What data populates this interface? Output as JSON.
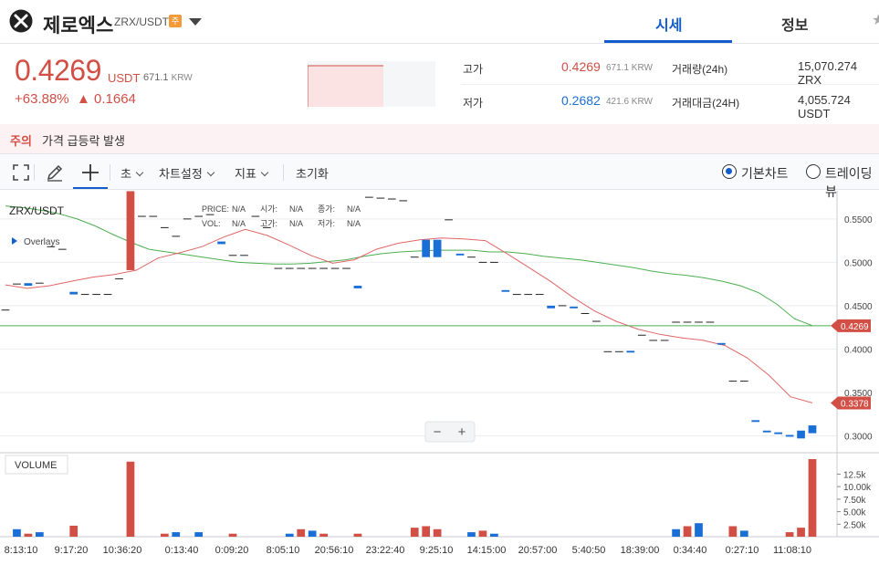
{
  "header": {
    "coin_name": "제로엑스",
    "pair": "ZRX/USDT",
    "warning_badge": "주",
    "tabs": [
      {
        "label": "시세",
        "active": true
      },
      {
        "label": "정보",
        "active": false
      }
    ]
  },
  "price": {
    "current": "0.4269",
    "unit": "USDT",
    "krw": "671.1",
    "krw_unit": "KRW",
    "change_pct": "+63.88%",
    "change_abs": "▲ 0.1664"
  },
  "stats": {
    "high_label": "고가",
    "high_value": "0.4269",
    "high_krw": "671.1 KRW",
    "low_label": "저가",
    "low_value": "0.2682",
    "low_krw": "421.6 KRW",
    "volume_label": "거래량(24h)",
    "volume_value": "15,070.274 ZRX",
    "amount_label": "거래대금(24H)",
    "amount_value": "4,055.724 USDT"
  },
  "banner": {
    "tag": "주의",
    "text": "가격 급등락 발생"
  },
  "toolbar": {
    "interval": "초",
    "chart_settings": "차트설정",
    "indicators": "지표",
    "reset": "초기화",
    "basic_chart": "기본차트",
    "tradingview": "트레이딩뷰"
  },
  "colors": {
    "up": "#d24f45",
    "down": "#1a6fd6",
    "accent": "#115dcb",
    "ma_green": "#4caf50",
    "ma_red": "#e06666"
  },
  "chart_data": {
    "type": "candlestick",
    "symbol": "ZRX/USDT",
    "overlays_label": "Overlays",
    "legend": {
      "price_label": "PRICE:",
      "price": "N/A",
      "open_label": "시가:",
      "open": "N/A",
      "close_label": "종가:",
      "close": "N/A",
      "vol_label": "VOL:",
      "vol": "N/A",
      "high_label": "고가:",
      "high": "N/A",
      "low_label": "저가:",
      "low": "N/A"
    },
    "y_ticks": [
      "0.5500",
      "0.5000",
      "0.4500",
      "0.4000",
      "0.3500",
      "0.3000"
    ],
    "y_tick_values": [
      0.55,
      0.5,
      0.45,
      0.4,
      0.35,
      0.3
    ],
    "ylim": [
      0.2805,
      0.5825
    ],
    "last_price_tag": "0.4269",
    "last_price_value": 0.4269,
    "ma_tag": "0.3378",
    "ma_tag_value": 0.3378,
    "x_ticks": [
      "8:13:10",
      "9:17:20",
      "10:36:20",
      "0:13:40",
      "0:09:20",
      "8:05:10",
      "20:56:10",
      "23:22:40",
      "9:25:10",
      "14:15:00",
      "20:57:00",
      "5:40:50",
      "18:39:00",
      "0:34:40",
      "0:27:10",
      "11:08:10"
    ],
    "volume_title": "VOLUME",
    "volume_ticks": [
      "12.5k",
      "10.00k",
      "7.50k",
      "5.00k",
      "2.50k"
    ],
    "volume_tick_values": [
      12500,
      10000,
      7500,
      5000,
      2500
    ],
    "volume_max": 15500,
    "candles": [
      {
        "i": 0,
        "o": 0.445,
        "c": 0.445,
        "h": 0.445,
        "l": 0.445
      },
      {
        "i": 1,
        "o": 0.475,
        "c": 0.475,
        "h": 0.475,
        "l": 0.475
      },
      {
        "i": 2,
        "o": 0.476,
        "c": 0.473,
        "h": 0.476,
        "l": 0.473
      },
      {
        "i": 3,
        "o": 0.476,
        "c": 0.476,
        "h": 0.476,
        "l": 0.476
      },
      {
        "i": 4,
        "o": 0.518,
        "c": 0.518,
        "h": 0.518,
        "l": 0.518
      },
      {
        "i": 5,
        "o": 0.515,
        "c": 0.515,
        "h": 0.515,
        "l": 0.515
      },
      {
        "i": 6,
        "o": 0.466,
        "c": 0.463,
        "h": 0.466,
        "l": 0.463
      },
      {
        "i": 7,
        "o": 0.463,
        "c": 0.463,
        "h": 0.463,
        "l": 0.463
      },
      {
        "i": 8,
        "o": 0.463,
        "c": 0.463,
        "h": 0.463,
        "l": 0.463
      },
      {
        "i": 9,
        "o": 0.463,
        "c": 0.463,
        "h": 0.463,
        "l": 0.463
      },
      {
        "i": 10,
        "o": 0.481,
        "c": 0.481,
        "h": 0.481,
        "l": 0.481
      },
      {
        "i": 11,
        "o": 0.491,
        "c": 0.582,
        "h": 0.582,
        "l": 0.491
      },
      {
        "i": 12,
        "o": 0.553,
        "c": 0.553,
        "h": 0.553,
        "l": 0.553
      },
      {
        "i": 13,
        "o": 0.553,
        "c": 0.553,
        "h": 0.553,
        "l": 0.553
      },
      {
        "i": 14,
        "o": 0.54,
        "c": 0.54,
        "h": 0.54,
        "l": 0.54
      },
      {
        "i": 15,
        "o": 0.53,
        "c": 0.53,
        "h": 0.53,
        "l": 0.53
      },
      {
        "i": 16,
        "o": 0.55,
        "c": 0.55,
        "h": 0.55,
        "l": 0.55
      },
      {
        "i": 17,
        "o": 0.553,
        "c": 0.553,
        "h": 0.553,
        "l": 0.553
      },
      {
        "i": 18,
        "o": 0.555,
        "c": 0.555,
        "h": 0.555,
        "l": 0.555
      },
      {
        "i": 19,
        "o": 0.524,
        "c": 0.521,
        "h": 0.524,
        "l": 0.521
      },
      {
        "i": 20,
        "o": 0.508,
        "c": 0.508,
        "h": 0.508,
        "l": 0.508
      },
      {
        "i": 21,
        "o": 0.508,
        "c": 0.508,
        "h": 0.508,
        "l": 0.508
      },
      {
        "i": 22,
        "o": 0.553,
        "c": 0.553,
        "h": 0.553,
        "l": 0.553
      },
      {
        "i": 23,
        "o": 0.54,
        "c": 0.54,
        "h": 0.54,
        "l": 0.54
      },
      {
        "i": 24,
        "o": 0.493,
        "c": 0.493,
        "h": 0.493,
        "l": 0.493
      },
      {
        "i": 25,
        "o": 0.493,
        "c": 0.493,
        "h": 0.493,
        "l": 0.493
      },
      {
        "i": 26,
        "o": 0.493,
        "c": 0.493,
        "h": 0.493,
        "l": 0.493
      },
      {
        "i": 27,
        "o": 0.493,
        "c": 0.493,
        "h": 0.493,
        "l": 0.493
      },
      {
        "i": 28,
        "o": 0.493,
        "c": 0.493,
        "h": 0.493,
        "l": 0.493
      },
      {
        "i": 29,
        "o": 0.493,
        "c": 0.493,
        "h": 0.493,
        "l": 0.493
      },
      {
        "i": 30,
        "o": 0.493,
        "c": 0.493,
        "h": 0.493,
        "l": 0.493
      },
      {
        "i": 31,
        "o": 0.473,
        "c": 0.47,
        "h": 0.473,
        "l": 0.47
      },
      {
        "i": 32,
        "o": 0.575,
        "c": 0.575,
        "h": 0.575,
        "l": 0.575
      },
      {
        "i": 33,
        "o": 0.574,
        "c": 0.574,
        "h": 0.574,
        "l": 0.574
      },
      {
        "i": 34,
        "o": 0.573,
        "c": 0.573,
        "h": 0.573,
        "l": 0.573
      },
      {
        "i": 35,
        "o": 0.571,
        "c": 0.571,
        "h": 0.571,
        "l": 0.571
      },
      {
        "i": 36,
        "o": 0.506,
        "c": 0.506,
        "h": 0.506,
        "l": 0.506
      },
      {
        "i": 37,
        "o": 0.526,
        "c": 0.506,
        "h": 0.526,
        "l": 0.506
      },
      {
        "i": 38,
        "o": 0.526,
        "c": 0.506,
        "h": 0.526,
        "l": 0.506
      },
      {
        "i": 39,
        "o": 0.549,
        "c": 0.549,
        "h": 0.549,
        "l": 0.549
      },
      {
        "i": 40,
        "o": 0.51,
        "c": 0.508,
        "h": 0.51,
        "l": 0.508
      },
      {
        "i": 41,
        "o": 0.506,
        "c": 0.506,
        "h": 0.506,
        "l": 0.506
      },
      {
        "i": 42,
        "o": 0.5,
        "c": 0.5,
        "h": 0.5,
        "l": 0.5
      },
      {
        "i": 43,
        "o": 0.5,
        "c": 0.5,
        "h": 0.5,
        "l": 0.5
      },
      {
        "i": 44,
        "o": 0.468,
        "c": 0.466,
        "h": 0.468,
        "l": 0.466
      },
      {
        "i": 45,
        "o": 0.463,
        "c": 0.463,
        "h": 0.463,
        "l": 0.463
      },
      {
        "i": 46,
        "o": 0.463,
        "c": 0.463,
        "h": 0.463,
        "l": 0.463
      },
      {
        "i": 47,
        "o": 0.463,
        "c": 0.463,
        "h": 0.463,
        "l": 0.463
      },
      {
        "i": 48,
        "o": 0.45,
        "c": 0.447,
        "h": 0.45,
        "l": 0.447
      },
      {
        "i": 49,
        "o": 0.45,
        "c": 0.45,
        "h": 0.45,
        "l": 0.45
      },
      {
        "i": 50,
        "o": 0.449,
        "c": 0.447,
        "h": 0.449,
        "l": 0.447
      },
      {
        "i": 51,
        "o": 0.441,
        "c": 0.441,
        "h": 0.441,
        "l": 0.441
      },
      {
        "i": 52,
        "o": 0.432,
        "c": 0.432,
        "h": 0.432,
        "l": 0.432
      },
      {
        "i": 53,
        "o": 0.397,
        "c": 0.397,
        "h": 0.397,
        "l": 0.397
      },
      {
        "i": 54,
        "o": 0.397,
        "c": 0.397,
        "h": 0.397,
        "l": 0.397
      },
      {
        "i": 55,
        "o": 0.398,
        "c": 0.396,
        "h": 0.398,
        "l": 0.396
      },
      {
        "i": 56,
        "o": 0.416,
        "c": 0.416,
        "h": 0.416,
        "l": 0.416
      },
      {
        "i": 57,
        "o": 0.41,
        "c": 0.41,
        "h": 0.41,
        "l": 0.41
      },
      {
        "i": 58,
        "o": 0.41,
        "c": 0.41,
        "h": 0.41,
        "l": 0.41
      },
      {
        "i": 59,
        "o": 0.431,
        "c": 0.431,
        "h": 0.431,
        "l": 0.431
      },
      {
        "i": 60,
        "o": 0.431,
        "c": 0.431,
        "h": 0.431,
        "l": 0.431
      },
      {
        "i": 61,
        "o": 0.431,
        "c": 0.431,
        "h": 0.431,
        "l": 0.431
      },
      {
        "i": 62,
        "o": 0.431,
        "c": 0.431,
        "h": 0.431,
        "l": 0.431
      },
      {
        "i": 63,
        "o": 0.407,
        "c": 0.405,
        "h": 0.407,
        "l": 0.405
      },
      {
        "i": 64,
        "o": 0.363,
        "c": 0.363,
        "h": 0.363,
        "l": 0.363
      },
      {
        "i": 65,
        "o": 0.363,
        "c": 0.363,
        "h": 0.363,
        "l": 0.363
      },
      {
        "i": 66,
        "o": 0.318,
        "c": 0.316,
        "h": 0.318,
        "l": 0.316
      },
      {
        "i": 67,
        "o": 0.306,
        "c": 0.304,
        "h": 0.306,
        "l": 0.304
      },
      {
        "i": 68,
        "o": 0.304,
        "c": 0.302,
        "h": 0.304,
        "l": 0.302
      },
      {
        "i": 69,
        "o": 0.301,
        "c": 0.299,
        "h": 0.301,
        "l": 0.299
      },
      {
        "i": 70,
        "o": 0.306,
        "c": 0.297,
        "h": 0.306,
        "l": 0.297
      },
      {
        "i": 71,
        "o": 0.312,
        "c": 0.303,
        "h": 0.312,
        "l": 0.303
      }
    ],
    "volume": [
      0,
      1500,
      600,
      900,
      0,
      0,
      2200,
      0,
      0,
      0,
      0,
      15000,
      0,
      0,
      600,
      900,
      0,
      900,
      0,
      0,
      600,
      0,
      0,
      0,
      0,
      600,
      1500,
      1200,
      600,
      0,
      0,
      600,
      0,
      0,
      0,
      0,
      1800,
      2100,
      1500,
      0,
      0,
      900,
      1200,
      600,
      0,
      0,
      0,
      0,
      0,
      0,
      0,
      0,
      0,
      0,
      0,
      0,
      0,
      0,
      0,
      1500,
      2100,
      2700,
      0,
      0,
      2100,
      1200,
      0,
      0,
      0,
      900,
      1800,
      15500
    ],
    "ma_green": [
      0.565,
      0.563,
      0.56,
      0.556,
      0.55,
      0.542,
      0.532,
      0.523,
      0.515,
      0.512,
      0.509,
      0.506,
      0.503,
      0.5,
      0.499,
      0.498,
      0.498,
      0.499,
      0.501,
      0.503,
      0.507,
      0.51,
      0.512,
      0.513,
      0.514,
      0.514,
      0.514,
      0.512,
      0.512,
      0.51,
      0.507,
      0.505,
      0.503,
      0.5,
      0.497,
      0.494,
      0.49,
      0.487,
      0.485,
      0.482,
      0.478,
      0.473,
      0.465,
      0.452,
      0.435,
      0.427
    ],
    "ma_red": [
      0.474,
      0.47,
      0.473,
      0.478,
      0.483,
      0.486,
      0.491,
      0.505,
      0.511,
      0.518,
      0.529,
      0.538,
      0.531,
      0.52,
      0.508,
      0.499,
      0.503,
      0.515,
      0.522,
      0.526,
      0.528,
      0.527,
      0.525,
      0.51,
      0.494,
      0.478,
      0.46,
      0.444,
      0.432,
      0.423,
      0.417,
      0.413,
      0.41,
      0.404,
      0.39,
      0.37,
      0.345,
      0.338
    ]
  }
}
